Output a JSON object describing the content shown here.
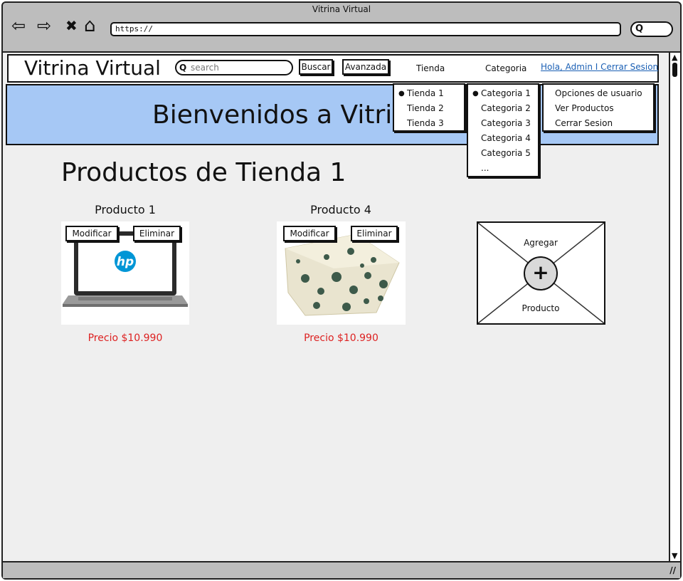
{
  "window": {
    "title": "Vitrina Virtual"
  },
  "browser": {
    "url": "https://",
    "back_glyph": "⇦",
    "forward_glyph": "⇨",
    "stop_glyph": "✖",
    "home_glyph": "⌂",
    "search_glyph": "Q"
  },
  "header": {
    "logo": "Vitrina Virtual",
    "search_placeholder": "search",
    "search_button": "Buscar",
    "advanced_button": "Avanzada",
    "menu_store": "Tienda",
    "menu_category": "Categoria",
    "user_link": "Hola, Admin I Cerrar Sesion"
  },
  "banner": {
    "text": "Bienvenidos a Vitrina Virtual"
  },
  "dropdowns": {
    "stores": [
      "Tienda 1",
      "Tienda 2",
      "Tienda 3"
    ],
    "categories": [
      "Categoria 1",
      "Categoria 2",
      "Categoria 3",
      "Categoria 4",
      "Categoria 5",
      "..."
    ],
    "user_options": [
      "Opciones de usuario",
      "Ver Productos",
      "Cerrar Sesion"
    ]
  },
  "main": {
    "heading": "Productos de Tienda 1",
    "products": [
      {
        "name": "Producto 1",
        "modify": "Modificar",
        "delete": "Eliminar",
        "price": "Precio $10.990",
        "brand_text": "hp"
      },
      {
        "name": "Producto 4",
        "modify": "Modificar",
        "delete": "Eliminar",
        "price": "Precio $10.990"
      }
    ],
    "add_card": {
      "top": "Agregar",
      "bottom": "Producto",
      "plus": "+"
    }
  },
  "colors": {
    "banner": "#a6c8f5",
    "price": "#d22222",
    "link": "#1a5fb4",
    "chrome": "#bdbdbd",
    "content": "#efefef"
  }
}
